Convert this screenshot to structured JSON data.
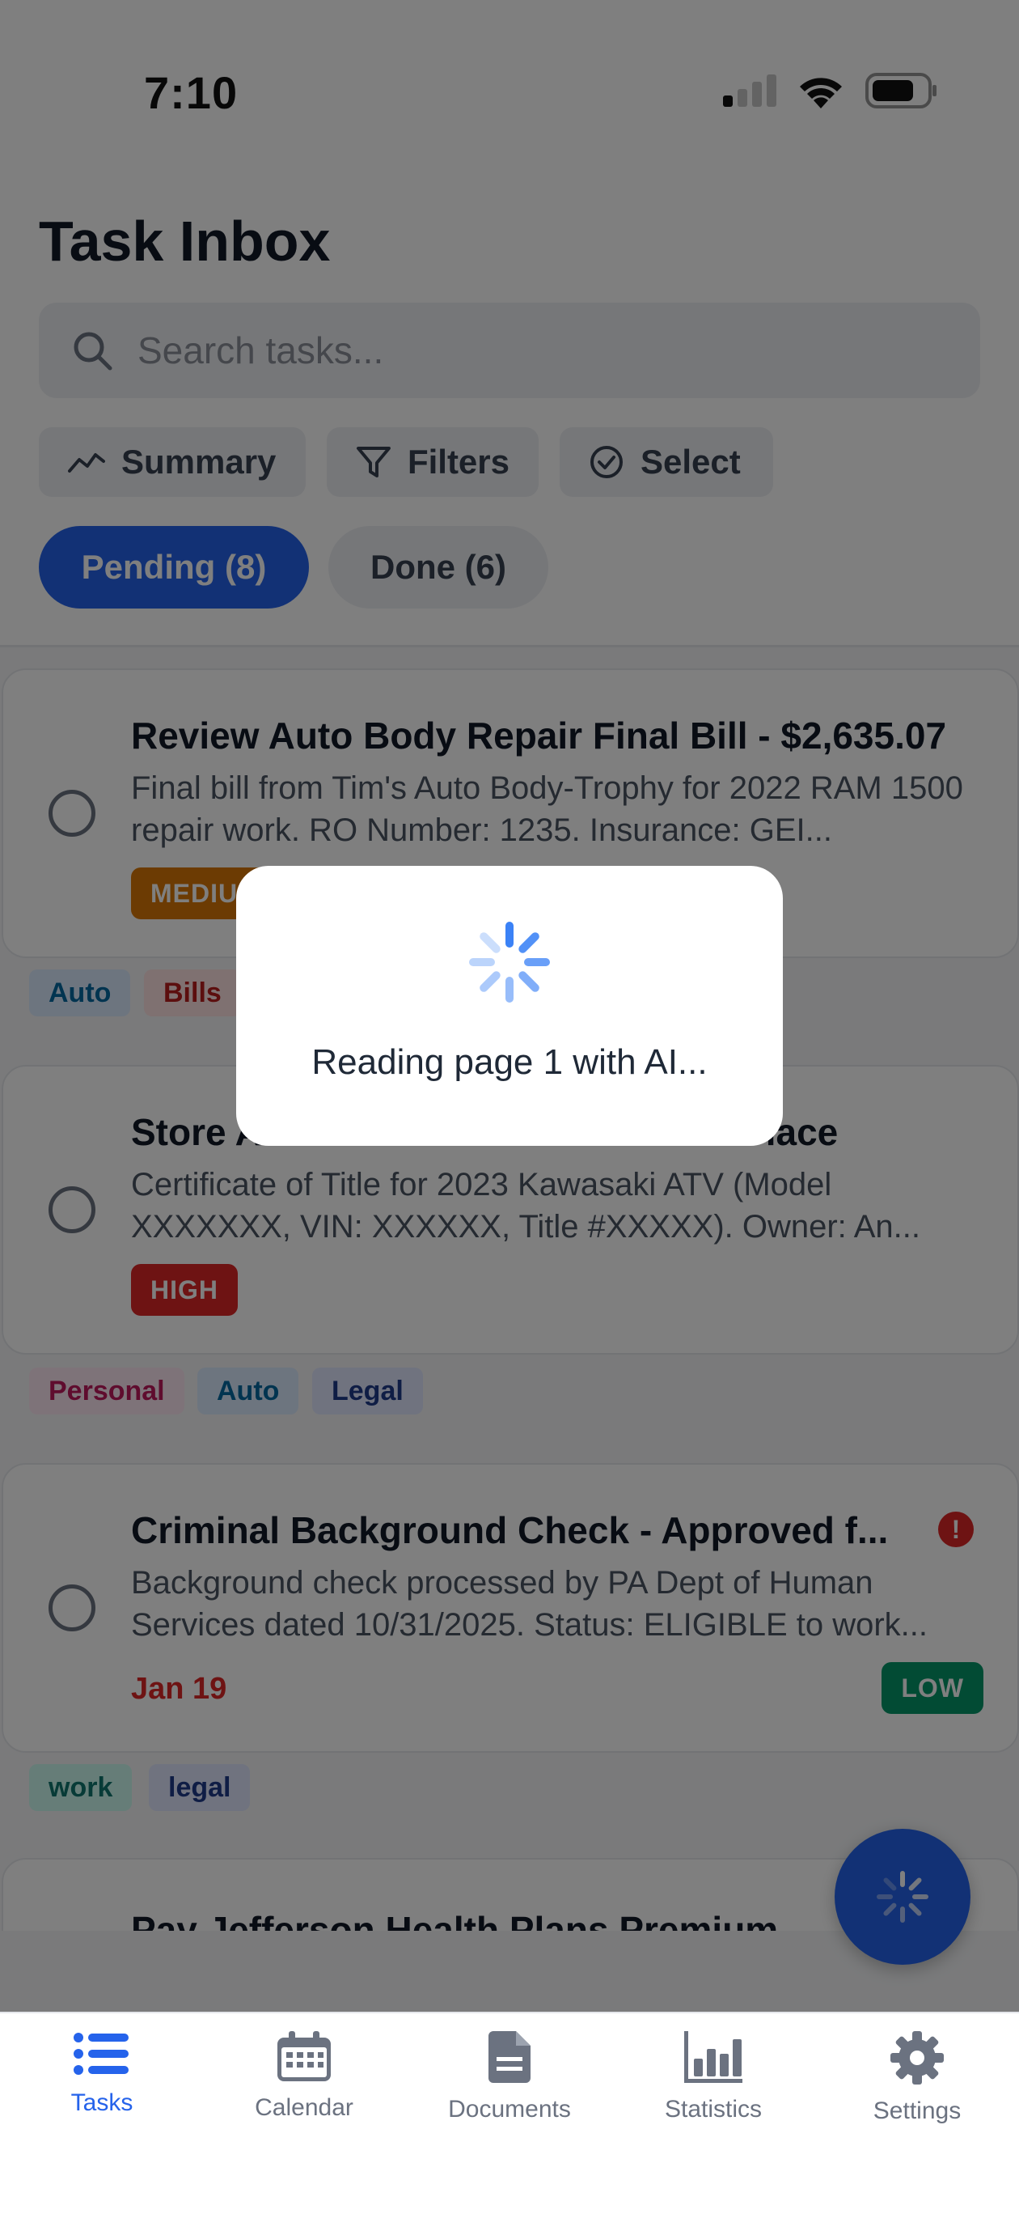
{
  "status_bar": {
    "time": "7:10"
  },
  "header": {
    "title": "Task Inbox",
    "search_placeholder": "Search tasks...",
    "buttons": {
      "summary": "Summary",
      "filters": "Filters",
      "select": "Select"
    },
    "tabs": {
      "pending": "Pending (8)",
      "done": "Done (6)"
    }
  },
  "tasks": [
    {
      "title": "Review Auto Body Repair Final Bill - $2,635.07",
      "description": "Final bill from Tim's Auto Body-Trophy for 2022 RAM 1500 repair work. RO Number: 1235. Insurance: GEI...",
      "priority": "MEDIUM",
      "priority_color": "#d97706",
      "tags": [
        "Auto",
        "Bills"
      ]
    },
    {
      "title": "Store Auto Title Certificate in Safe Place",
      "description": "Certificate of Title for 2023 Kawasaki ATV (Model XXXXXXX, VIN: XXXXXX, Title #XXXXX). Owner: An...",
      "priority": "HIGH",
      "priority_color": "#dc2626",
      "tags": [
        "Personal",
        "Auto",
        "Legal"
      ]
    },
    {
      "title": "Criminal Background Check - Approved f...",
      "description": "Background check processed by PA Dept of Human Services dated 10/31/2025. Status: ELIGIBLE to work...",
      "due": "Jan 19",
      "alert": "!",
      "priority": "LOW",
      "priority_color": "#059669",
      "tags": [
        "work",
        "legal"
      ]
    },
    {
      "title": "Pay Jefferson Health Plans Premium"
    }
  ],
  "modal": {
    "text": "Reading page 1 with AI..."
  },
  "tabbar": {
    "tasks": "Tasks",
    "calendar": "Calendar",
    "documents": "Documents",
    "statistics": "Statistics",
    "settings": "Settings"
  },
  "colors": {
    "accent": "#2563eb",
    "overlay": "rgba(0,0,0,0.5)"
  }
}
